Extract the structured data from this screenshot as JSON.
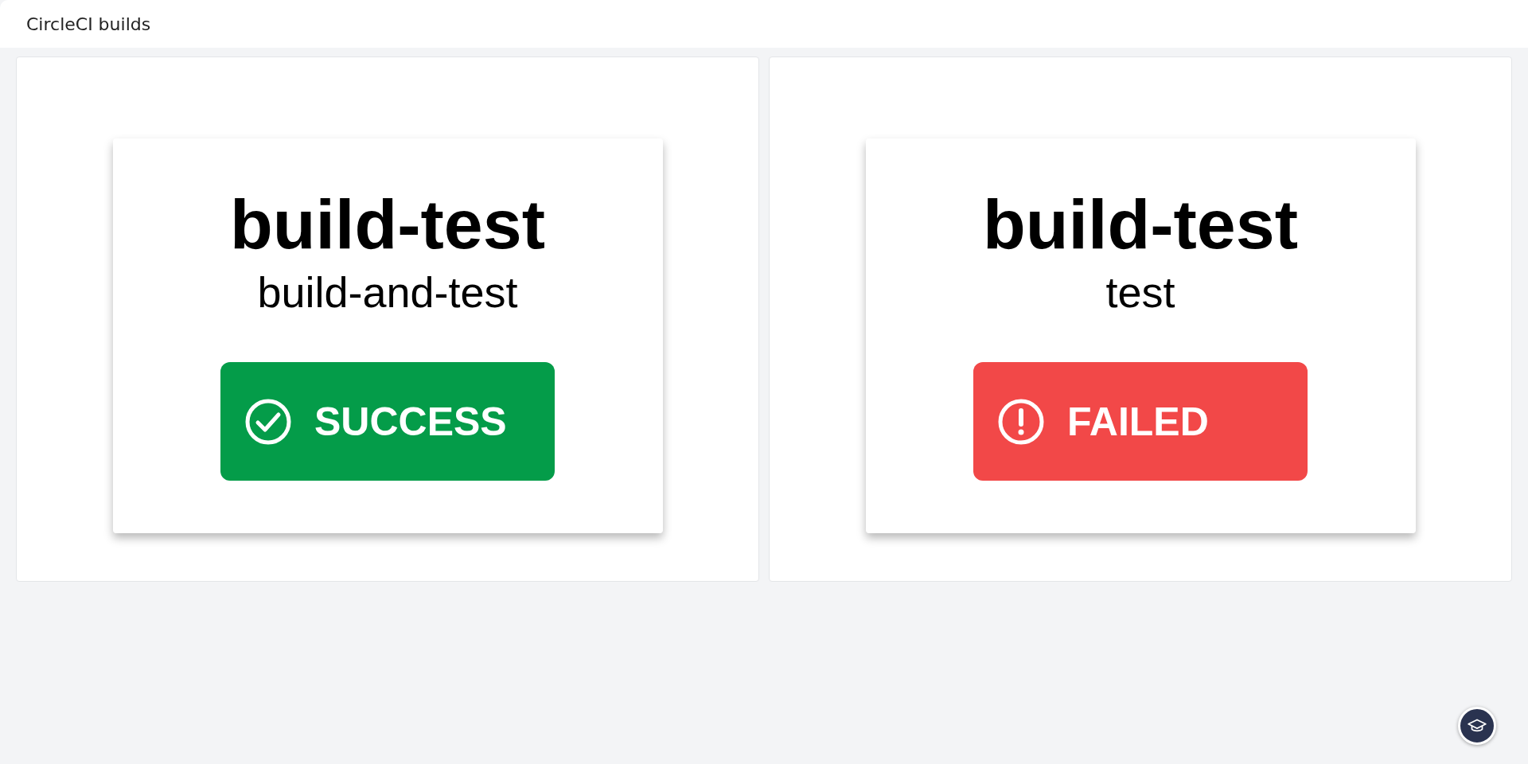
{
  "header": {
    "title": "CircleCI builds"
  },
  "builds": [
    {
      "title": "build-test",
      "subtitle": "build-and-test",
      "status": {
        "kind": "success",
        "label": "SUCCESS"
      }
    },
    {
      "title": "build-test",
      "subtitle": "test",
      "status": {
        "kind": "failed",
        "label": "FAILED"
      }
    }
  ]
}
